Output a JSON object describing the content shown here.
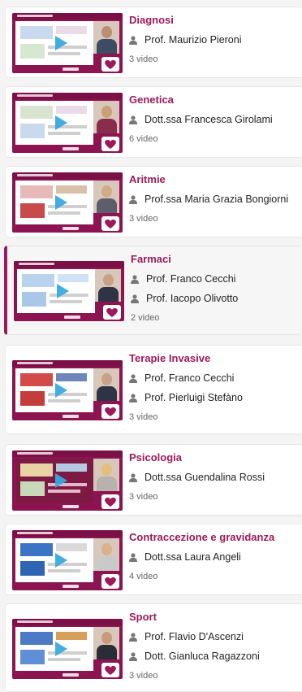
{
  "courses": [
    {
      "title": "Diagnosi",
      "authors": [
        "Prof. Maurizio Pieroni"
      ],
      "count": "3 video"
    },
    {
      "title": "Genetica",
      "authors": [
        "Dott.ssa Francesca Girolami"
      ],
      "count": "6 video"
    },
    {
      "title": "Aritmie",
      "authors": [
        "Prof.ssa Maria Grazia Bongiorni"
      ],
      "count": "3 video"
    },
    {
      "title": "Farmaci",
      "authors": [
        "Prof. Franco Cecchi",
        "Prof. Iacopo Olivotto"
      ],
      "count": "2 video"
    },
    {
      "title": "Terapie Invasive",
      "authors": [
        "Prof. Franco Cecchi",
        "Prof. Pierluigi Stefàno"
      ],
      "count": "3 video"
    },
    {
      "title": "Psicologia",
      "authors": [
        "Dott.ssa Guendalina Rossi"
      ],
      "count": "3 video"
    },
    {
      "title": "Contraccezione e gravidanza",
      "authors": [
        "Dott.ssa Laura Angeli"
      ],
      "count": "4 video"
    },
    {
      "title": "Sport",
      "authors": [
        "Prof. Flavio D'Ascenzi",
        "Dott. Gianluca Ragazzoni"
      ],
      "count": "3 video"
    }
  ],
  "colors": {
    "accent": "#9c1a5b",
    "thumb_bg": "#8c1450",
    "play": "#3aa9e0"
  },
  "icons": {
    "author": "person-icon",
    "play": "play-icon",
    "brand": "heart-logo-icon"
  }
}
